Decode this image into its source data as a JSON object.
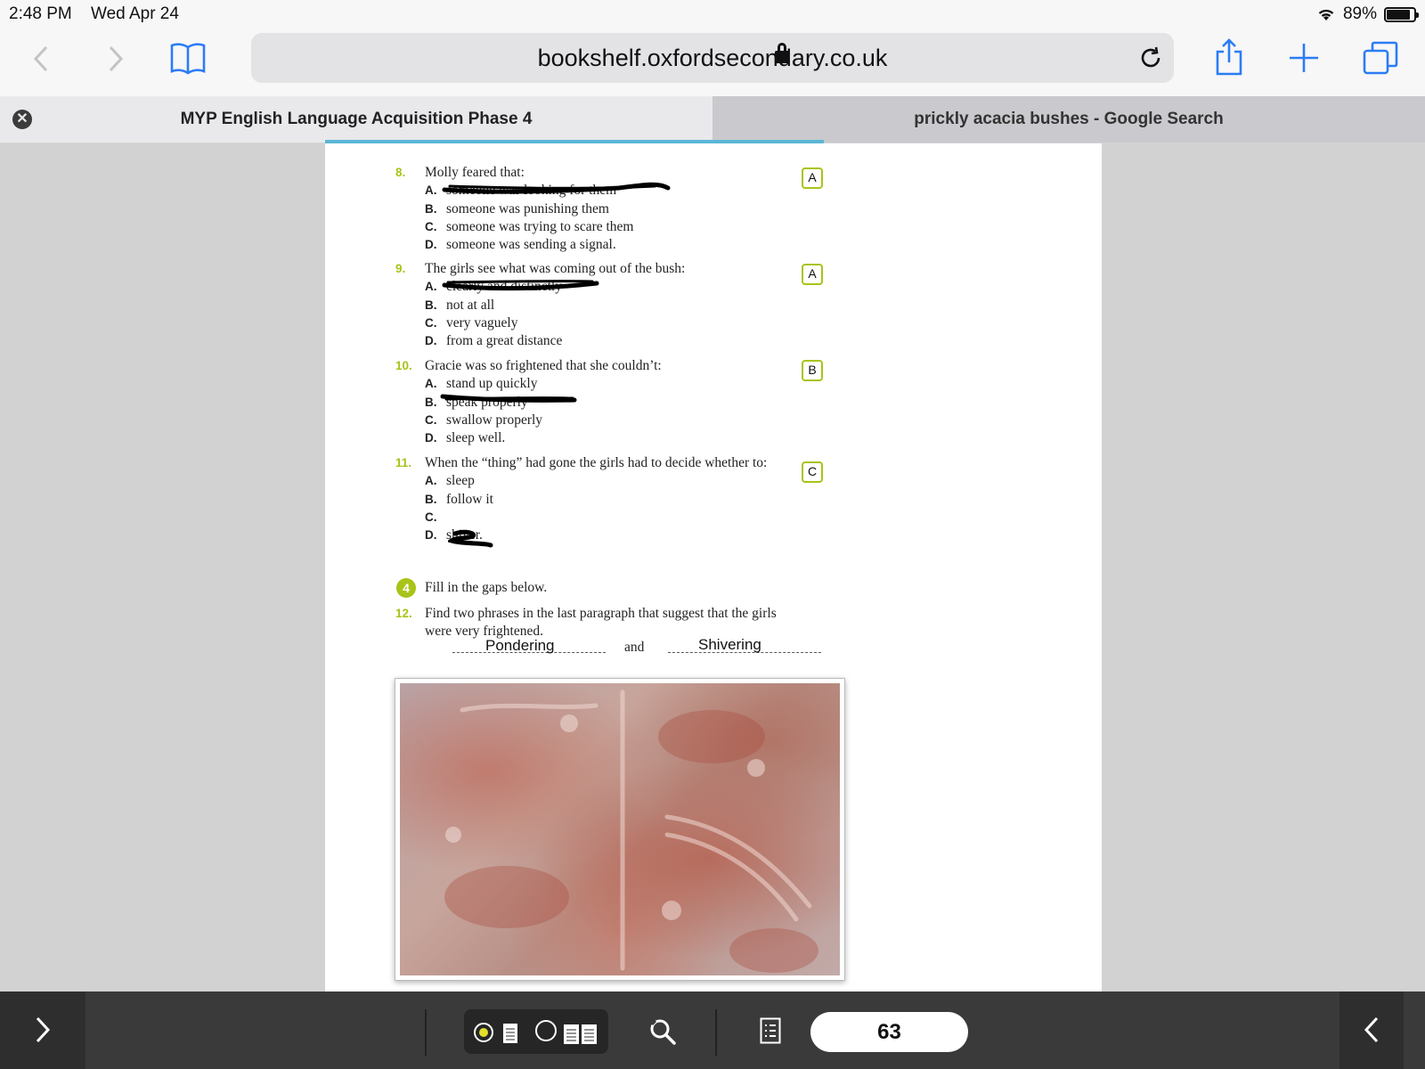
{
  "status": {
    "time": "2:48 PM",
    "date": "Wed Apr 24",
    "battery": "89%",
    "battery_level": 0.89
  },
  "toolbar": {
    "url": "bookshelf.oxfordsecondary.co.uk"
  },
  "tabs": [
    {
      "title": "MYP English Language Acquisition Phase 4",
      "active": true
    },
    {
      "title": "prickly acacia bushes - Google Search",
      "active": false
    }
  ],
  "questions": [
    {
      "number": "8.",
      "prompt": "Molly feared that:",
      "answer": "A",
      "options": [
        {
          "letter": "A.",
          "text": "someone was looking for them"
        },
        {
          "letter": "B.",
          "text": "someone was punishing them"
        },
        {
          "letter": "C.",
          "text": "someone was trying to scare them"
        },
        {
          "letter": "D.",
          "text": "someone was sending a signal."
        }
      ]
    },
    {
      "number": "9.",
      "prompt": "The girls see what was coming out of the bush:",
      "answer": "A",
      "options": [
        {
          "letter": "A.",
          "text": "clearly and distinctly"
        },
        {
          "letter": "B.",
          "text": "not at all"
        },
        {
          "letter": "C.",
          "text": "very vaguely"
        },
        {
          "letter": "D.",
          "text": "from a great distance"
        }
      ]
    },
    {
      "number": "10.",
      "prompt": "Gracie was so frightened that she couldn’t:",
      "answer": "B",
      "options": [
        {
          "letter": "A.",
          "text": "stand up quickly"
        },
        {
          "letter": "B.",
          "text": "speak properly"
        },
        {
          "letter": "C.",
          "text": "swallow properly"
        },
        {
          "letter": "D.",
          "text": "sleep well."
        }
      ]
    },
    {
      "number": "11.",
      "prompt": "When the “thing” had gone the girls had to decide whether to:",
      "answer": "C",
      "options": [
        {
          "letter": "A.",
          "text": "sleep"
        },
        {
          "letter": "B.",
          "text": "follow it"
        },
        {
          "letter": "C.",
          "text": ""
        },
        {
          "letter": "D.",
          "text": "shiver."
        }
      ]
    }
  ],
  "section4": {
    "badge": "4",
    "instruction": "Fill in the gaps below."
  },
  "question12": {
    "number": "12.",
    "prompt": "Find two phrases in the last paragraph that suggest that the girls were very frightened.",
    "answer1": "Pondering",
    "joiner": "and",
    "answer2": "Shivering"
  },
  "bottombar": {
    "page_number": "63"
  }
}
